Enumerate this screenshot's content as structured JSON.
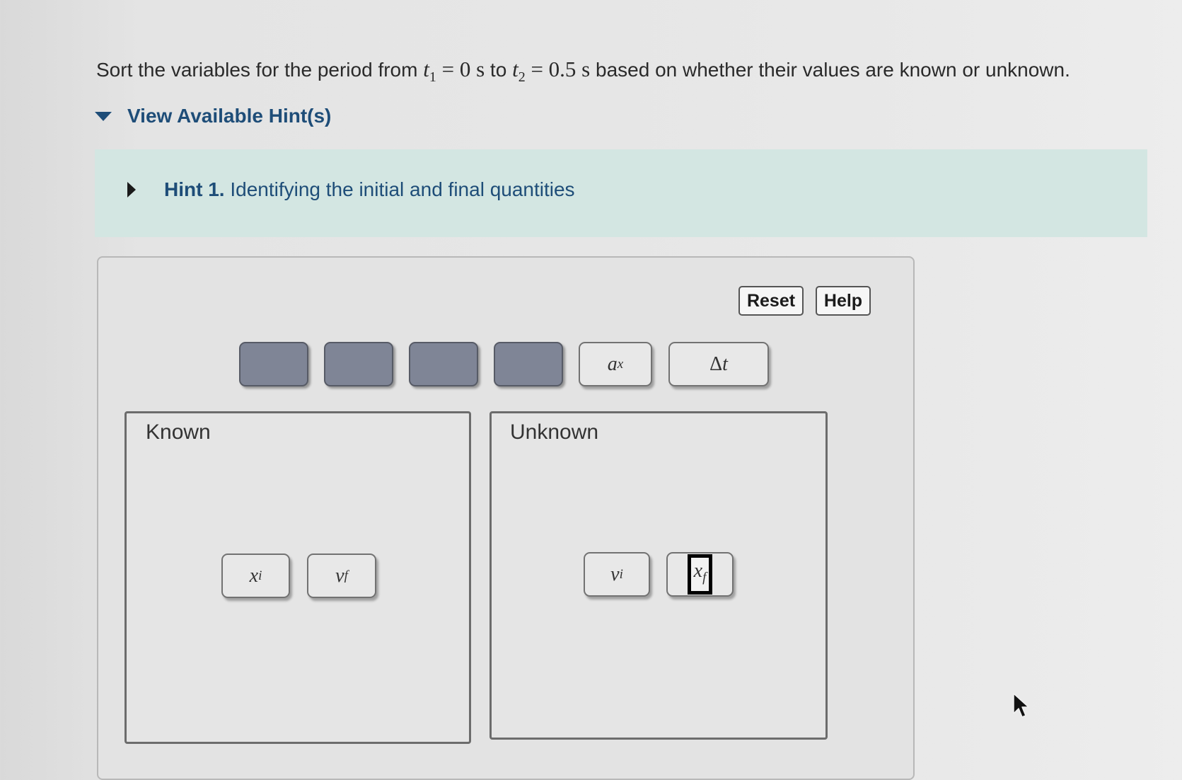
{
  "question": {
    "prefix": "Sort the variables for the period from ",
    "t1_symbol": "t",
    "t1_sub": "1",
    "t1_eq": " = 0 s",
    "middle": " to ",
    "t2_symbol": "t",
    "t2_sub": "2",
    "t2_eq": " = 0.5 s",
    "suffix": " based on whether their values are known or unknown."
  },
  "hints": {
    "toggle_label": "View Available Hint(s)",
    "hint1_number": "Hint 1.",
    "hint1_title": " Identifying the initial and final quantities"
  },
  "toolbar": {
    "reset_label": "Reset",
    "help_label": "Help"
  },
  "source_chips": [
    {
      "symbol": "a",
      "sub": "x"
    },
    {
      "symbol": "t",
      "prefix": "Δ"
    }
  ],
  "zones": {
    "known": {
      "label": "Known",
      "chips": [
        {
          "symbol": "x",
          "sub": "i"
        },
        {
          "symbol": "v",
          "sub": "f"
        }
      ]
    },
    "unknown": {
      "label": "Unknown",
      "chips": [
        {
          "symbol": "v",
          "sub": "i"
        },
        {
          "symbol": "x",
          "sub": "f"
        }
      ]
    }
  },
  "colors": {
    "link_blue": "#1e4d78",
    "hint_panel": "#d3e6e2",
    "empty_slot": "#7f8596"
  }
}
